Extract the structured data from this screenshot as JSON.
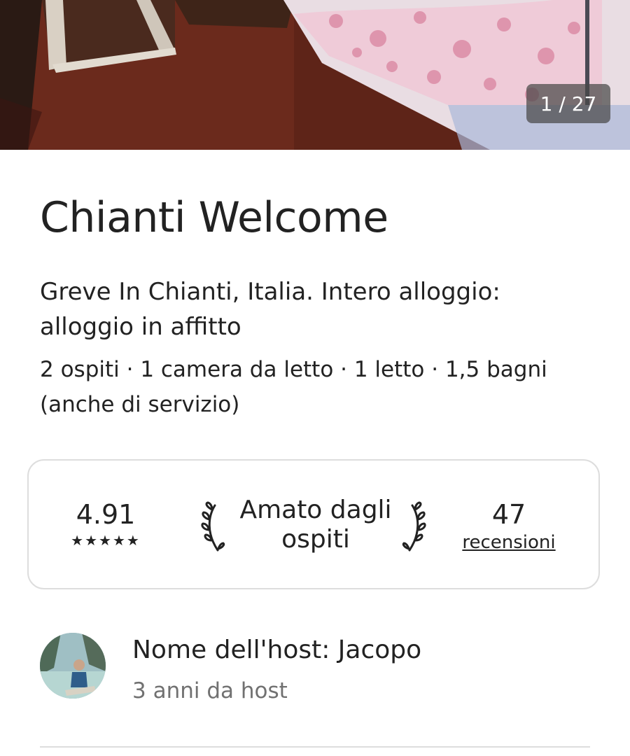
{
  "photo": {
    "counter": "1 / 27"
  },
  "listing": {
    "title": "Chianti Welcome",
    "subtitle": "Greve In Chianti, Italia. Intero alloggio: alloggio in affitto",
    "details": "2 ospiti · 1 camera da letto · 1 letto · 1,5 bagni (anche di servizio)"
  },
  "highlights": {
    "rating": "4.91",
    "stars": "★★★★★",
    "star_count": 5,
    "guest_favorite": "Amato dagli ospiti",
    "reviews_count": "47",
    "reviews_label": "recensioni"
  },
  "host": {
    "name_line": "Nome dell'host: Jacopo",
    "since": "3 anni da host"
  },
  "colors": {
    "text_primary": "#222222",
    "text_secondary": "#717171",
    "border": "#dddddd",
    "counter_bg": "#484848"
  }
}
